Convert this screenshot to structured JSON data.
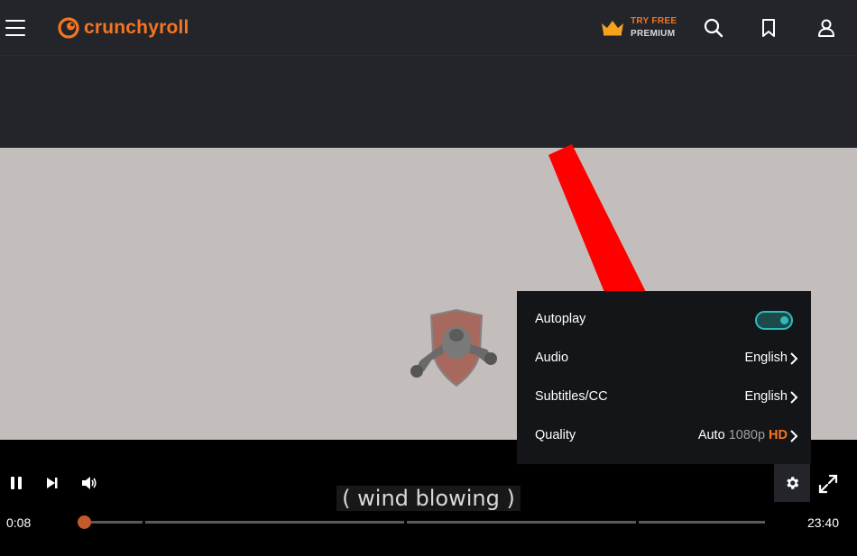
{
  "app": {
    "logo_text": "crunchyroll",
    "accent_color": "#f47521"
  },
  "header": {
    "premium_line1": "TRY FREE",
    "premium_line2": "PREMIUM",
    "icons": [
      "menu-icon",
      "crown-icon",
      "search-icon",
      "bookmark-icon",
      "user-icon"
    ]
  },
  "player": {
    "caption": "( wind blowing )",
    "current_time": "0:08",
    "duration": "23:40",
    "progress_fraction": 0.0056,
    "icons": [
      "pause-icon",
      "skip-next-icon",
      "volume-icon",
      "gear-icon",
      "fullscreen-icon"
    ]
  },
  "settings_menu": {
    "autoplay": {
      "label": "Autoplay",
      "enabled": true
    },
    "audio": {
      "label": "Audio",
      "value": "English"
    },
    "subtitles": {
      "label": "Subtitles/CC",
      "value": "English"
    },
    "quality": {
      "label": "Quality",
      "value_mode": "Auto",
      "value_res": "1080p",
      "value_badge": "HD"
    },
    "toggle_color": "#2abdbb"
  },
  "overlay": {
    "arrow_color": "#ff0000"
  }
}
